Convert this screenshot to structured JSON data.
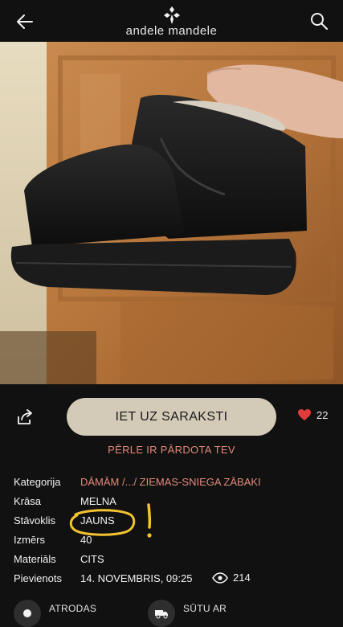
{
  "header": {
    "logo_text": "andele mandele",
    "icons": [
      "back-arrow-icon",
      "logo-icon",
      "search-icon"
    ]
  },
  "actions": {
    "primary_label": "IET UZ SARAKSTI",
    "like_count": "22",
    "icons": [
      "share-icon",
      "heart-icon"
    ],
    "accent_color": "#e03c3c"
  },
  "sold_note": "PĒRLE IR PĀRDOTA TEV",
  "details": [
    {
      "label": "Kategorija",
      "value": "DĀMĀM /.../ ZIEMAS-SNIEGA ZĀBAKI"
    },
    {
      "label": "Krāsa",
      "value": "MELNA"
    },
    {
      "label": "Stāvoklis",
      "value": "JAUNS"
    },
    {
      "label": "Izmērs",
      "value": "40"
    },
    {
      "label": "Materiāls",
      "value": "CITS"
    },
    {
      "label": "Pievienots",
      "value": "14. NOVEMBRIS, 09:25",
      "views": "214"
    }
  ],
  "bottom": {
    "items": [
      {
        "label": "ATRODAS",
        "icon": "location-icon"
      },
      {
        "label": "SŪTU AR",
        "icon": "delivery-truck-icon"
      }
    ]
  },
  "colors": {
    "background": "#111111",
    "button": "#d4cab8",
    "link": "#e08a7a",
    "annotation": "#f2c230"
  }
}
